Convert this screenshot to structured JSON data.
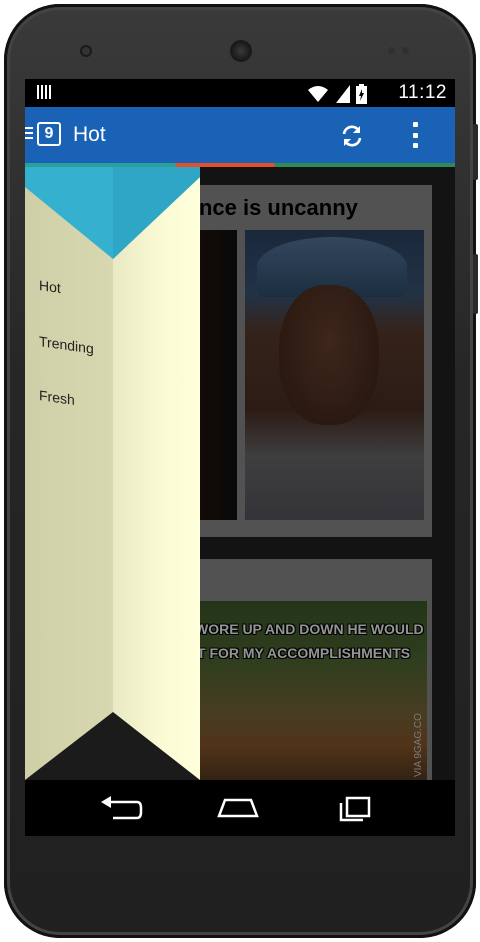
{
  "statusbar": {
    "time": "11:12",
    "icons": [
      "wifi-icon",
      "signal-icon",
      "battery-charging-icon"
    ]
  },
  "appbar": {
    "logo_letter": "9",
    "title": "Hot",
    "actions": [
      "refresh-icon",
      "overflow-menu-icon"
    ]
  },
  "feed": {
    "card1": {
      "title": "...rese...nce is uncanny"
    },
    "card2": {
      "meme_line1": "WORE UP AND DOWN HE WOULD",
      "meme_line2": "T FOR MY ACCOMPLISHMENTS",
      "watermark": "VIA 9GAG.CO"
    }
  },
  "drawer": {
    "items": [
      {
        "label": "Hot",
        "selected": true
      },
      {
        "label": "Trending",
        "selected": false
      },
      {
        "label": "Fresh",
        "selected": false
      }
    ],
    "colors": {
      "selected": "#36b0cf",
      "panel": "#fdfdd6"
    }
  },
  "colors": {
    "appbar": "#1a62b6",
    "statusbar": "#000000"
  },
  "navbar": {
    "buttons": [
      "back-icon",
      "home-icon",
      "recents-icon"
    ]
  }
}
